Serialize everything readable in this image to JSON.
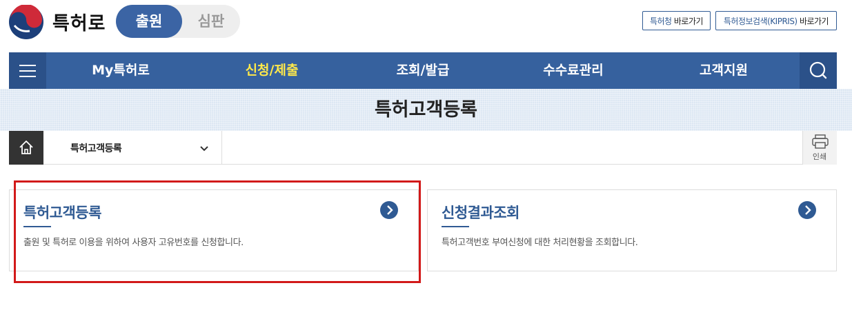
{
  "header": {
    "site_name": "특허로",
    "mode_tabs": [
      {
        "label": "출원",
        "active": true
      },
      {
        "label": "심판",
        "active": false
      }
    ],
    "top_links": [
      {
        "highlight": "특허청",
        "suffix": " 바로가기"
      },
      {
        "highlight": "특허정보검색(KIPRIS)",
        "suffix": " 바로가기"
      }
    ]
  },
  "nav": {
    "menu_icon": "hamburger-icon",
    "search_icon": "search-icon",
    "items": [
      {
        "label": "My특허로",
        "active": false
      },
      {
        "label": "신청/제출",
        "active": true
      },
      {
        "label": "조회/발급",
        "active": false
      },
      {
        "label": "수수료관리",
        "active": false
      },
      {
        "label": "고객지원",
        "active": false
      }
    ]
  },
  "page": {
    "title": "특허고객등록"
  },
  "breadcrumb": {
    "home_icon": "home-icon",
    "current": "특허고객등록",
    "print_label": "인쇄"
  },
  "cards": [
    {
      "title": "특허고객등록",
      "desc": "출원 및 특허로 이용을 위하여 사용자 고유번호를 신청합니다.",
      "highlighted": true
    },
    {
      "title": "신청결과조회",
      "desc": "특허고객번호 부여신청에 대한 처리현황을 조회합니다.",
      "highlighted": false
    }
  ],
  "colors": {
    "nav_bg": "#36619e",
    "nav_active": "#ffe94a",
    "accent": "#2f5a93",
    "highlight_border": "#d21919"
  }
}
